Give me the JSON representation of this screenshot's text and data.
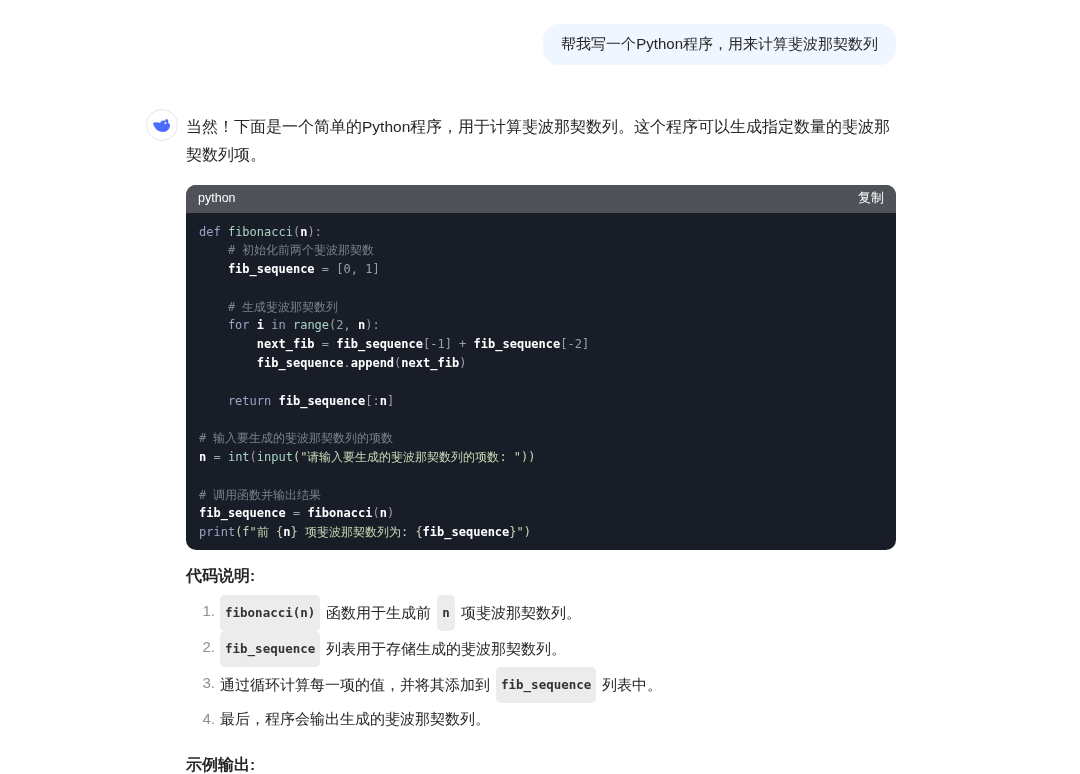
{
  "user_message": "帮我写一个Python程序，用来计算斐波那契数列",
  "reply": {
    "intro": "当然！下面是一个简单的Python程序，用于计算斐波那契数列。这个程序可以生成指定数量的斐波那契数列项。",
    "code_block": {
      "language": "python",
      "copy_label": "复制",
      "lines": [
        {
          "kind": "code",
          "tokens": [
            {
              "text": "def ",
              "kind": "kw"
            },
            {
              "text": "fibonacci",
              "kind": "fn"
            },
            {
              "text": "(",
              "kind": "p"
            },
            {
              "text": "n",
              "kind": "var"
            },
            {
              "text": "):",
              "kind": "p"
            }
          ]
        },
        {
          "kind": "code",
          "tokens": [
            {
              "text": "    # 初始化前两个斐波那契数",
              "kind": "comment"
            }
          ]
        },
        {
          "kind": "code",
          "tokens": [
            {
              "text": "    fib_sequence",
              "kind": "var"
            },
            {
              "text": " = [",
              "kind": "p"
            },
            {
              "text": "0, 1",
              "kind": "num"
            },
            {
              "text": "]",
              "kind": "p"
            }
          ]
        },
        {
          "kind": "blank"
        },
        {
          "kind": "code",
          "tokens": [
            {
              "text": "    # 生成斐波那契数列",
              "kind": "comment"
            }
          ]
        },
        {
          "kind": "code",
          "tokens": [
            {
              "text": "    for ",
              "kind": "kw"
            },
            {
              "text": "i",
              "kind": "var"
            },
            {
              "text": " in ",
              "kind": "kw"
            },
            {
              "text": "range",
              "kind": "fn"
            },
            {
              "text": "(2, ",
              "kind": "p"
            },
            {
              "text": "n",
              "kind": "var"
            },
            {
              "text": "):",
              "kind": "p"
            }
          ]
        },
        {
          "kind": "code",
          "tokens": [
            {
              "text": "        next_fib",
              "kind": "var"
            },
            {
              "text": " = ",
              "kind": "p"
            },
            {
              "text": "fib_sequence",
              "kind": "var"
            },
            {
              "text": "[-1] + ",
              "kind": "p"
            },
            {
              "text": "fib_sequence",
              "kind": "var"
            },
            {
              "text": "[-2]",
              "kind": "p"
            }
          ]
        },
        {
          "kind": "code",
          "tokens": [
            {
              "text": "        fib_sequence",
              "kind": "var"
            },
            {
              "text": ".",
              "kind": "p"
            },
            {
              "text": "append",
              "kind": "var"
            },
            {
              "text": "(",
              "kind": "p"
            },
            {
              "text": "next_fib",
              "kind": "var"
            },
            {
              "text": ")",
              "kind": "p"
            }
          ]
        },
        {
          "kind": "blank"
        },
        {
          "kind": "code",
          "tokens": [
            {
              "text": "    return ",
              "kind": "kw"
            },
            {
              "text": "fib_sequence",
              "kind": "var"
            },
            {
              "text": "[:",
              "kind": "p"
            },
            {
              "text": "n",
              "kind": "var"
            },
            {
              "text": "]",
              "kind": "p"
            }
          ]
        },
        {
          "kind": "blank"
        },
        {
          "kind": "code",
          "tokens": [
            {
              "text": "# 输入要生成的斐波那契数列的项数",
              "kind": "comment"
            }
          ]
        },
        {
          "kind": "code",
          "tokens": [
            {
              "text": "n",
              "kind": "var"
            },
            {
              "text": " = ",
              "kind": "p"
            },
            {
              "text": "int",
              "kind": "fn"
            },
            {
              "text": "(",
              "kind": "p"
            },
            {
              "text": "input",
              "kind": "fn"
            },
            {
              "text": "(\"请输入要生成的斐波那契数列的项数: \"))",
              "kind": "str"
            }
          ]
        },
        {
          "kind": "blank"
        },
        {
          "kind": "code",
          "tokens": [
            {
              "text": "# 调用函数并输出结果",
              "kind": "comment"
            }
          ]
        },
        {
          "kind": "code",
          "tokens": [
            {
              "text": "fib_sequence",
              "kind": "var"
            },
            {
              "text": " = ",
              "kind": "p"
            },
            {
              "text": "fibonacci",
              "kind": "var"
            },
            {
              "text": "(",
              "kind": "p"
            },
            {
              "text": "n",
              "kind": "var"
            },
            {
              "text": ")",
              "kind": "p"
            }
          ]
        },
        {
          "kind": "code",
          "tokens": [
            {
              "text": "print",
              "kind": "kw"
            },
            {
              "text": "(f\"前 {",
              "kind": "str"
            },
            {
              "text": "n",
              "kind": "var"
            },
            {
              "text": "} 项斐波那契数列为: {",
              "kind": "str"
            },
            {
              "text": "fib_sequence",
              "kind": "var"
            },
            {
              "text": "}\")",
              "kind": "str"
            }
          ]
        }
      ]
    },
    "sections": [
      {
        "heading": "代码说明:",
        "items": [
          {
            "number": "1.",
            "parts": [
              {
                "text": "fibonacci(n)",
                "kind": "code"
              },
              {
                "text": "函数用于生成前",
                "kind": "text"
              },
              {
                "text": "n",
                "kind": "code"
              },
              {
                "text": "项斐波那契数列。",
                "kind": "text"
              }
            ]
          },
          {
            "number": "2.",
            "parts": [
              {
                "text": "fib_sequence",
                "kind": "code"
              },
              {
                "text": "列表用于存储生成的斐波那契数列。",
                "kind": "text"
              }
            ]
          },
          {
            "number": "3.",
            "parts": [
              {
                "text": "通过循环计算每一项的值，并将其添加到",
                "kind": "text"
              },
              {
                "text": "fib_sequence",
                "kind": "code"
              },
              {
                "text": "列表中。",
                "kind": "text"
              }
            ]
          },
          {
            "number": "4.",
            "parts": [
              {
                "text": "最后，程序会输出生成的斐波那契数列。",
                "kind": "text"
              }
            ]
          }
        ]
      },
      {
        "heading": "示例输出:"
      }
    ]
  }
}
